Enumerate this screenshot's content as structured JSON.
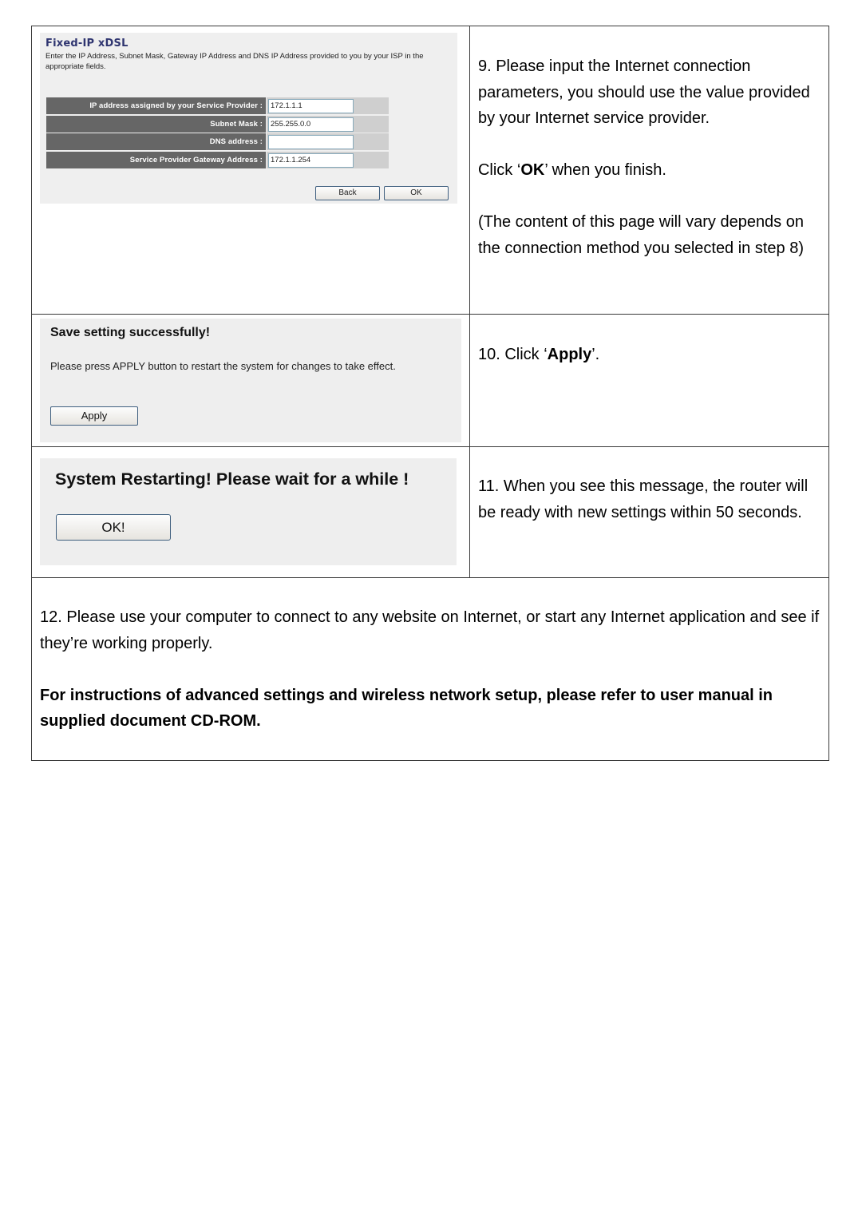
{
  "fixed_ip_panel": {
    "title": "Fixed-IP xDSL",
    "description": "Enter the IP Address, Subnet Mask, Gateway IP Address and DNS IP Address provided to you by your ISP in the appropriate fields.",
    "fields": [
      {
        "label": "IP address assigned by your Service Provider :",
        "value": "172.1.1.1"
      },
      {
        "label": "Subnet Mask :",
        "value": "255.255.0.0"
      },
      {
        "label": "DNS address :",
        "value": ""
      },
      {
        "label": "Service Provider Gateway Address :",
        "value": "172.1.1.254"
      }
    ],
    "back_label": "Back",
    "ok_label": "OK",
    "title_color": "#2f3570"
  },
  "step9": {
    "para1": "9. Please input the Internet connection parameters, you should use the value provided by your Internet service provider.",
    "para2_pre": "Click ‘",
    "para2_bold": "OK",
    "para2_post": "’ when you finish.",
    "para3": "(The content of this page will vary depends on the connection method you selected in step 8)"
  },
  "save_panel": {
    "title": "Save setting successfully!",
    "description": "Please press APPLY button to restart the system for changes to take effect.",
    "apply_label": "Apply"
  },
  "step10": {
    "pre": "10. Click ‘",
    "bold": "Apply",
    "post": "’."
  },
  "restart_panel": {
    "title": "System Restarting! Please wait for a while !",
    "ok_label": "OK!"
  },
  "step11": {
    "text": "11. When you see this message, the router will be ready with new settings within 50 seconds."
  },
  "step12": {
    "text": "12. Please use your computer to connect to any website on Internet, or start any Internet application and see if they’re working properly.",
    "note": "For instructions of advanced settings and wireless network setup, please refer to user manual in supplied document CD-ROM."
  }
}
